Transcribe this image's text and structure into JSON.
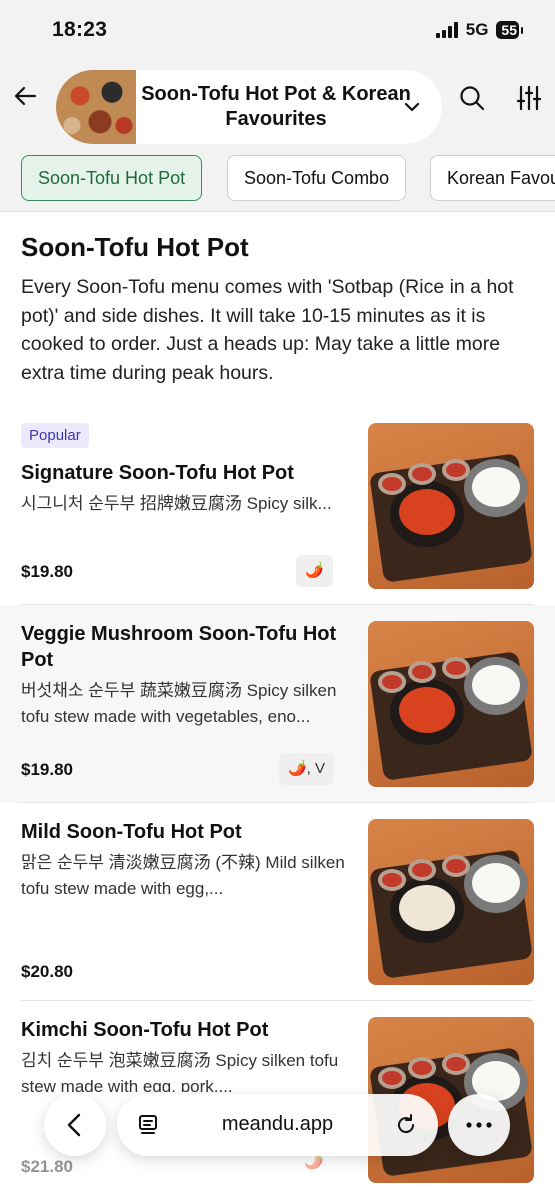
{
  "status_bar": {
    "time": "18:23",
    "network": "5G",
    "battery": "55"
  },
  "header": {
    "title": "Soon-Tofu Hot Pot & Korean Favourites"
  },
  "tabs": [
    {
      "label": "Soon-Tofu Hot Pot",
      "active": true
    },
    {
      "label": "Soon-Tofu Combo",
      "active": false
    },
    {
      "label": "Korean Favourites",
      "active": false
    }
  ],
  "section": {
    "title": "Soon-Tofu Hot Pot",
    "description": "Every Soon-Tofu menu comes with 'Sotbap (Rice in a hot pot)' and side dishes. It will take 10-15 minutes as it is cooked to order. Just a heads up: May take a little more extra time during peak hours."
  },
  "items": [
    {
      "badge": "Popular",
      "name": "Signature Soon-Tofu Hot Pot",
      "description": "시그니처 순두부 招牌嫩豆腐汤 Spicy silk...",
      "price": "$19.80",
      "tags": "🌶️"
    },
    {
      "name": "Veggie Mushroom Soon-Tofu Hot Pot",
      "description": "버섯채소 순두부 蔬菜嫩豆腐汤 Spicy silken tofu stew made with vegetables, eno...",
      "price": "$19.80",
      "tags": "🌶️, V"
    },
    {
      "name": "Mild Soon-Tofu Hot Pot",
      "description": "맑은 순두부 清淡嫩豆腐汤 (不辣) Mild silken tofu stew made with egg,...",
      "price": "$20.80",
      "tags": ""
    },
    {
      "name": "Kimchi Soon-Tofu Hot Pot",
      "description": "김치 순두부 泡菜嫩豆腐汤 Spicy silken tofu stew made with egg, pork,...",
      "price": "$21.80",
      "tags": "🌶️"
    }
  ],
  "browser": {
    "url": "meandu.app"
  },
  "icons": {
    "back": "arrow-left-icon",
    "chevron": "chevron-down-icon",
    "search": "search-icon",
    "filter": "sliders-icon",
    "browser_back": "chevron-left-icon",
    "tabs": "tabs-icon",
    "reload": "reload-icon",
    "more": "more-icon"
  },
  "colors": {
    "active_tab_bg": "#e5f3ea",
    "active_tab_border": "#3c8a5c",
    "popular_badge": "#ebe9fb"
  }
}
